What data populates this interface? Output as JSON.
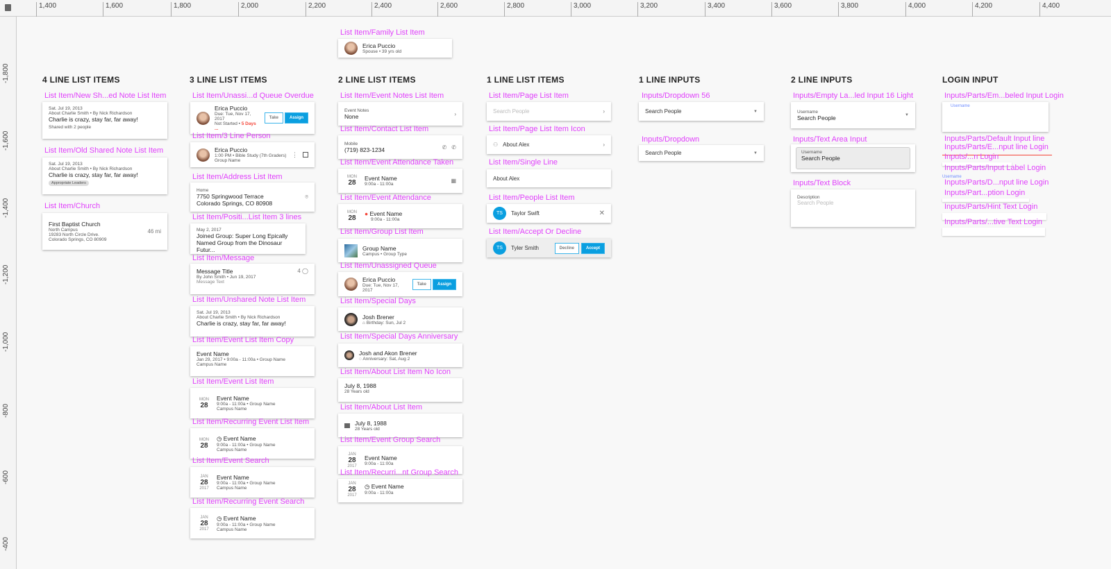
{
  "ruler": {
    "top": [
      "1,400",
      "1,600",
      "1,800",
      "2,000",
      "2,200",
      "2,400",
      "2,600",
      "2,800",
      "3,000",
      "3,200",
      "3,400",
      "3,600",
      "3,800",
      "4,000",
      "4,200",
      "4,400"
    ],
    "left": [
      "-1,800",
      "-1,600",
      "-1,400",
      "-1,200",
      "-1,000",
      "-800",
      "-600",
      "-400"
    ]
  },
  "headings": {
    "c1": "4 LINE LIST ITEMS",
    "c2": "3 LINE LIST ITEMS",
    "c3": "2 LINE LIST ITEMS",
    "c4": "1 LINE LIST ITEMS",
    "c5": "1 LINE INPUTS",
    "c6": "2 LINE INPUTS",
    "c7": "LOGIN INPUT"
  },
  "c1": {
    "new_note": {
      "label": "List Item/New Sh...ed Note List Item",
      "date": "Sat. Jul 19, 2013",
      "about": "About Charlie Smith • By Nick Richardson",
      "text": "Charlie is crazy, stay far, far away!",
      "shared": "Shared with 2 people"
    },
    "old_note": {
      "label": "List Item/Old Shared Note List Item",
      "date": "Sat. Jul 19, 2013",
      "about": "About Charlie Smith • By Nick Richardson",
      "text": "Charlie is crazy, stay far, far away!",
      "chip": "Appropriate Leaders"
    },
    "church": {
      "label": "List Item/Church",
      "name": "First Baptist Church",
      "campus": "North Campus",
      "street": "19283 North Circle Drive.",
      "city": "Colorado Springs, CO 80909",
      "distance": "46 mi"
    }
  },
  "c2": {
    "overdue": {
      "label": "List Item/Unassi...d Queue Overdue",
      "name": "Erica Puccio",
      "due": "Due: Tue, Nov 17, 2017",
      "status": "Not Started • ",
      "late": "5 Days ...",
      "take": "Take",
      "assign": "Assign"
    },
    "person3": {
      "label": "List Item/3 Line Person",
      "name": "Erica Puccio",
      "line2": "1:00 PM • Bible Study (7th Graders)",
      "line3": "Group Name"
    },
    "address": {
      "label": "List Item/Address List Item",
      "type": "Home",
      "line1": "7750 Springwood Terrace",
      "line2": "Colorado Springs, CO 80908"
    },
    "position": {
      "label": "List Item/Positi...List Item 3 lines",
      "date": "May 2, 2017",
      "line1": "Joined Group: Super Long Epically",
      "line2": "Named Group from the Dinosaur Futur..."
    },
    "message": {
      "label": "List Item/Message",
      "title": "Message Title",
      "by": "By John Smith • Jun 19, 2017",
      "text": "Message Text",
      "count": "4"
    },
    "unshared": {
      "label": "List Item/Unshared Note List Item",
      "date": "Sat. Jul 19, 2013",
      "about": "About Charlie Smith • By Nick Richardson",
      "text": "Charlie is crazy, stay far, far away!"
    },
    "event_copy": {
      "label": "List Item/Event List Item Copy",
      "name": "Event Name",
      "line2": "Jan 29, 2017 • 9:00a - 11:00a • Group Name",
      "line3": "Campus Name"
    },
    "event": {
      "label": "List Item/Event List Item",
      "dow": "MON",
      "day": "28",
      "name": "Event Name",
      "line2": "9:00a - 11:00a • Group Name",
      "line3": "Campus Name"
    },
    "recurring": {
      "label": "List Item/Recurring Event List Item",
      "dow": "MON",
      "day": "28",
      "name": "Event Name",
      "line2": "9:00a - 11:00a • Group Name",
      "line3": "Campus Name"
    },
    "search": {
      "label": "List Item/Event Search",
      "mon": "JAN",
      "day": "28",
      "year": "2017",
      "name": "Event Name",
      "line2": "9:00a - 11:00a • Group Name",
      "line3": "Campus Name"
    },
    "rsearch": {
      "label": "List Item/Recurring Event Search",
      "mon": "JAN",
      "day": "28",
      "year": "2017",
      "name": "Event Name",
      "line2": "9:00a - 11:00a • Group Name",
      "line3": "Campus Name"
    }
  },
  "c3": {
    "family": {
      "label": "List Item/Family List Item",
      "name": "Erica Puccio",
      "sub": "Spouse • 39 yrs old"
    },
    "notes": {
      "label": "List Item/Event Notes List Item",
      "title": "Event Notes",
      "value": "None"
    },
    "contact": {
      "label": "List Item/Contact List Item",
      "title": "Mobile",
      "value": "(719) 823-1234"
    },
    "att_taken": {
      "label": "List Item/Event Attendance Taken",
      "dow": "MON",
      "day": "28",
      "name": "Event Name",
      "time": "9:00a - 11:00a"
    },
    "att": {
      "label": "List Item/Event Attendance",
      "dow": "MON",
      "day": "28",
      "name": "Event Name",
      "time": "9:00a - 11:00a"
    },
    "group": {
      "label": "List Item/Group List Item",
      "name": "Group Name",
      "sub": "Campus • Group Type"
    },
    "queue": {
      "label": "List Item/Unassigned Queue",
      "name": "Erica Puccio",
      "due": "Due: Tue, Nov 17, 2017",
      "take": "Take",
      "assign": "Assign"
    },
    "special": {
      "label": "List Item/Special Days",
      "name": "Josh Brener",
      "sub": "Birthday: Sun, Jul 2"
    },
    "anniv": {
      "label": "List Item/Special Days Anniversary",
      "name": "Josh and Akon Brener",
      "sub": "Anniversary: Sat, Aug 2"
    },
    "about_no": {
      "label": "List Item/About List Item No Icon",
      "date": "July 8, 1988",
      "age": "28 Years old"
    },
    "about": {
      "label": "List Item/About List Item",
      "date": "July 8, 1988",
      "age": "28 Years old"
    },
    "gsearch": {
      "label": "List Item/Event Group Search",
      "mon": "JAN",
      "day": "28",
      "year": "2017",
      "name": "Event Name",
      "time": "9:00a - 11:00a"
    },
    "rgsearch": {
      "label": "List Item/Recurri...nt Group Search",
      "mon": "JAN",
      "day": "28",
      "year": "2017",
      "name": "Event Name",
      "time": "9:00a - 11:00a"
    }
  },
  "c4": {
    "page": {
      "label": "List Item/Page List Item",
      "placeholder": "Search People"
    },
    "page_icon": {
      "label": "List Item/Page List Item Icon",
      "text": "About Alex"
    },
    "single": {
      "label": "List Item/Single Line",
      "text": "About Alex"
    },
    "people": {
      "label": "List Item/People List Item",
      "initials": "TS",
      "name": "Taylor Swift"
    },
    "accept": {
      "label": "List Item/Accept Or Decline",
      "initials": "TS",
      "name": "Tyler Smith",
      "decline": "Decline",
      "accept": "Accept"
    }
  },
  "c5": {
    "dd56": {
      "label": "Inputs/Dropdown 56",
      "value": "Search People"
    },
    "dd": {
      "label": "Inputs/Dropdown",
      "value": "Search People"
    }
  },
  "c6": {
    "empty": {
      "label": "Inputs/Empty La...led Input 16 Light",
      "title": "Username",
      "value": "Search People"
    },
    "textarea": {
      "label": "Inputs/Text Area Input",
      "title": "Username",
      "value": "Search People"
    },
    "block": {
      "label": "Inputs/Text Block",
      "title": "Description",
      "placeholder": "Search People"
    }
  },
  "c7": {
    "empty_login": {
      "label": "Inputs/Parts/Em...beled Input Login",
      "title": "Username"
    },
    "labels": [
      "Inputs/Parts/Default Input line",
      "Inputs/Parts/E...nput line Login",
      "Inputs/...n Login",
      "Inputs/Parts/Input Label Login",
      "Inputs/Parts/D...nput line Login",
      "Inputs/Part...ption Login",
      "Inputs/Parts/Hint Text Login",
      "Inputs/Parts/...tive Text Login"
    ],
    "input_label": "Username"
  },
  "colors": {
    "label": "#e040fb",
    "accent": "#0a9fe0",
    "error": "#f44336",
    "canvas": "#f8f8f8"
  }
}
